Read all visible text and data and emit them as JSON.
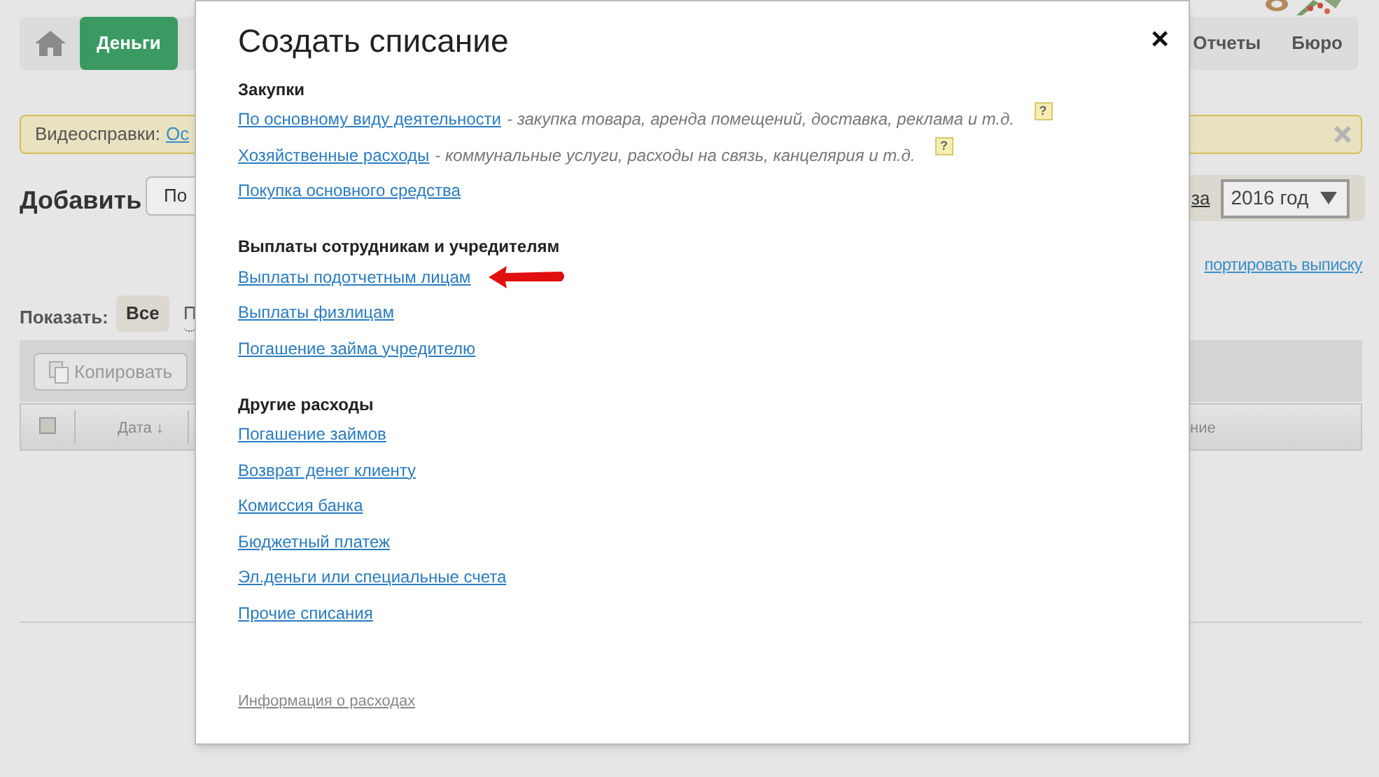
{
  "nav": {
    "left_tabs": [
      {
        "label": "Деньги",
        "selected": true
      }
    ],
    "right_tabs": [
      {
        "label": "Отчеты",
        "selected": false
      },
      {
        "label": "Бюро",
        "selected": false
      }
    ]
  },
  "banner": {
    "label": "Видеосправки:",
    "link": "Ос"
  },
  "add": {
    "title": "Добавить",
    "button": "По"
  },
  "period": {
    "link": "за",
    "year_select": "2016 год"
  },
  "import_link": "портировать выписку",
  "filter": {
    "label": "Показать:",
    "options": [
      {
        "label": "Все",
        "selected": true
      },
      {
        "label": "П",
        "selected": false
      }
    ]
  },
  "table": {
    "copy_button": "Копировать",
    "header_checkbox": {
      "checked": false
    },
    "columns": [
      "Дата ↓",
      "ние"
    ]
  },
  "modal": {
    "title": "Создать списание",
    "close": "×",
    "sections": [
      {
        "heading": "Закупки",
        "items": [
          {
            "link": "По основному виду деятельности",
            "note": "- закупка товара, аренда помещений, доставка, реклама и т.д.",
            "help": "?",
            "marked": false
          },
          {
            "link": "Хозяйственные расходы",
            "note": "- коммунальные услуги, расходы на связь, канцелярия и т.д.",
            "help": "?",
            "marked": false
          },
          {
            "link": "Покупка основного средства",
            "marked": false
          }
        ]
      },
      {
        "heading": "Выплаты сотрудникам и учредителям",
        "items": [
          {
            "link": "Выплаты подотчетным лицам",
            "marked": true
          },
          {
            "link": "Выплаты физлицам",
            "marked": false
          },
          {
            "link": "Погашение займа учредителю",
            "marked": false
          }
        ]
      },
      {
        "heading": "Другие расходы",
        "items": [
          {
            "link": "Погашение займов",
            "marked": false
          },
          {
            "link": "Возврат денег клиенту",
            "marked": false
          },
          {
            "link": "Комиссия банка",
            "marked": false
          },
          {
            "link": "Бюджетный платеж",
            "marked": false
          },
          {
            "link": "Эл.деньги или специальные счета",
            "marked": false
          },
          {
            "link": "Прочие списания",
            "marked": false
          }
        ]
      }
    ],
    "footer_link": "Информация о расходах"
  }
}
